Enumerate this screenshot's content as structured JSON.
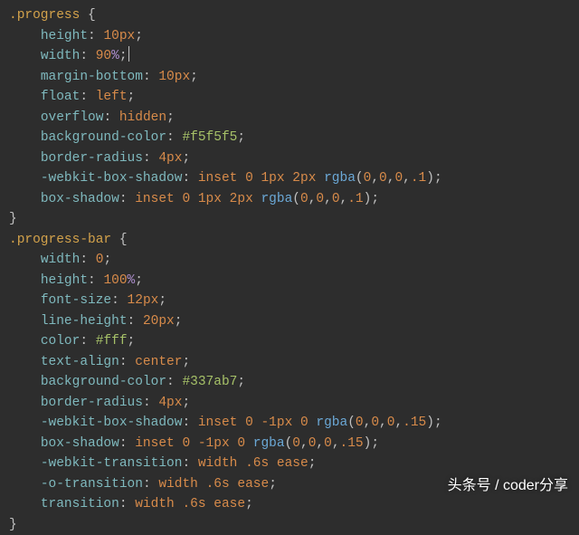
{
  "rules": [
    {
      "selector": ".progress",
      "decls": [
        {
          "prop": "height",
          "tokens": [
            {
              "t": "num",
              "v": "10px"
            }
          ]
        },
        {
          "prop": "width",
          "tokens": [
            {
              "t": "num",
              "v": "90"
            },
            {
              "t": "pct",
              "v": "%"
            }
          ],
          "cursor": true
        },
        {
          "prop": "margin-bottom",
          "tokens": [
            {
              "t": "num",
              "v": "10px"
            }
          ]
        },
        {
          "prop": "float",
          "tokens": [
            {
              "t": "kw",
              "v": "left"
            }
          ]
        },
        {
          "prop": "overflow",
          "tokens": [
            {
              "t": "kw",
              "v": "hidden"
            }
          ]
        },
        {
          "prop": "background-color",
          "tokens": [
            {
              "t": "str",
              "v": "#f5f5f5"
            }
          ]
        },
        {
          "prop": "border-radius",
          "tokens": [
            {
              "t": "num",
              "v": "4px"
            }
          ]
        },
        {
          "prop": "-webkit-box-shadow",
          "tokens": [
            {
              "t": "kw",
              "v": "inset"
            },
            {
              "t": "sp"
            },
            {
              "t": "num",
              "v": "0"
            },
            {
              "t": "sp"
            },
            {
              "t": "num",
              "v": "1px"
            },
            {
              "t": "sp"
            },
            {
              "t": "num",
              "v": "2px"
            },
            {
              "t": "sp"
            },
            {
              "t": "func",
              "v": "rgba"
            },
            {
              "t": "punc",
              "v": "("
            },
            {
              "t": "num",
              "v": "0"
            },
            {
              "t": "punc",
              "v": ","
            },
            {
              "t": "num",
              "v": "0"
            },
            {
              "t": "punc",
              "v": ","
            },
            {
              "t": "num",
              "v": "0"
            },
            {
              "t": "punc",
              "v": ","
            },
            {
              "t": "num",
              "v": ".1"
            },
            {
              "t": "punc",
              "v": ")"
            }
          ]
        },
        {
          "prop": "box-shadow",
          "tokens": [
            {
              "t": "kw",
              "v": "inset"
            },
            {
              "t": "sp"
            },
            {
              "t": "num",
              "v": "0"
            },
            {
              "t": "sp"
            },
            {
              "t": "num",
              "v": "1px"
            },
            {
              "t": "sp"
            },
            {
              "t": "num",
              "v": "2px"
            },
            {
              "t": "sp"
            },
            {
              "t": "func",
              "v": "rgba"
            },
            {
              "t": "punc",
              "v": "("
            },
            {
              "t": "num",
              "v": "0"
            },
            {
              "t": "punc",
              "v": ","
            },
            {
              "t": "num",
              "v": "0"
            },
            {
              "t": "punc",
              "v": ","
            },
            {
              "t": "num",
              "v": "0"
            },
            {
              "t": "punc",
              "v": ","
            },
            {
              "t": "num",
              "v": ".1"
            },
            {
              "t": "punc",
              "v": ")"
            }
          ]
        }
      ]
    },
    {
      "selector": ".progress-bar",
      "decls": [
        {
          "prop": "width",
          "tokens": [
            {
              "t": "num",
              "v": "0"
            }
          ]
        },
        {
          "prop": "height",
          "tokens": [
            {
              "t": "num",
              "v": "100"
            },
            {
              "t": "pct",
              "v": "%"
            }
          ]
        },
        {
          "prop": "font-size",
          "tokens": [
            {
              "t": "num",
              "v": "12px"
            }
          ]
        },
        {
          "prop": "line-height",
          "tokens": [
            {
              "t": "num",
              "v": "20px"
            }
          ]
        },
        {
          "prop": "color",
          "tokens": [
            {
              "t": "str",
              "v": "#fff"
            }
          ]
        },
        {
          "prop": "text-align",
          "tokens": [
            {
              "t": "kw",
              "v": "center"
            }
          ]
        },
        {
          "prop": "background-color",
          "tokens": [
            {
              "t": "str",
              "v": "#337ab7"
            }
          ]
        },
        {
          "prop": "border-radius",
          "tokens": [
            {
              "t": "num",
              "v": "4px"
            }
          ]
        },
        {
          "prop": "-webkit-box-shadow",
          "tokens": [
            {
              "t": "kw",
              "v": "inset"
            },
            {
              "t": "sp"
            },
            {
              "t": "num",
              "v": "0"
            },
            {
              "t": "sp"
            },
            {
              "t": "num",
              "v": "-1px"
            },
            {
              "t": "sp"
            },
            {
              "t": "num",
              "v": "0"
            },
            {
              "t": "sp"
            },
            {
              "t": "func",
              "v": "rgba"
            },
            {
              "t": "punc",
              "v": "("
            },
            {
              "t": "num",
              "v": "0"
            },
            {
              "t": "punc",
              "v": ","
            },
            {
              "t": "num",
              "v": "0"
            },
            {
              "t": "punc",
              "v": ","
            },
            {
              "t": "num",
              "v": "0"
            },
            {
              "t": "punc",
              "v": ","
            },
            {
              "t": "num",
              "v": ".15"
            },
            {
              "t": "punc",
              "v": ")"
            }
          ]
        },
        {
          "prop": "box-shadow",
          "tokens": [
            {
              "t": "kw",
              "v": "inset"
            },
            {
              "t": "sp"
            },
            {
              "t": "num",
              "v": "0"
            },
            {
              "t": "sp"
            },
            {
              "t": "num",
              "v": "-1px"
            },
            {
              "t": "sp"
            },
            {
              "t": "num",
              "v": "0"
            },
            {
              "t": "sp"
            },
            {
              "t": "func",
              "v": "rgba"
            },
            {
              "t": "punc",
              "v": "("
            },
            {
              "t": "num",
              "v": "0"
            },
            {
              "t": "punc",
              "v": ","
            },
            {
              "t": "num",
              "v": "0"
            },
            {
              "t": "punc",
              "v": ","
            },
            {
              "t": "num",
              "v": "0"
            },
            {
              "t": "punc",
              "v": ","
            },
            {
              "t": "num",
              "v": ".15"
            },
            {
              "t": "punc",
              "v": ")"
            }
          ]
        },
        {
          "prop": "-webkit-transition",
          "tokens": [
            {
              "t": "kw",
              "v": "width"
            },
            {
              "t": "sp"
            },
            {
              "t": "num",
              "v": ".6s"
            },
            {
              "t": "sp"
            },
            {
              "t": "kw",
              "v": "ease"
            }
          ]
        },
        {
          "prop": "-o-transition",
          "tokens": [
            {
              "t": "kw",
              "v": "width"
            },
            {
              "t": "sp"
            },
            {
              "t": "num",
              "v": ".6s"
            },
            {
              "t": "sp"
            },
            {
              "t": "kw",
              "v": "ease"
            }
          ]
        },
        {
          "prop": "transition",
          "tokens": [
            {
              "t": "kw",
              "v": "width"
            },
            {
              "t": "sp"
            },
            {
              "t": "num",
              "v": ".6s"
            },
            {
              "t": "sp"
            },
            {
              "t": "kw",
              "v": "ease"
            }
          ]
        }
      ]
    }
  ],
  "watermark": "头条号 / coder分享"
}
